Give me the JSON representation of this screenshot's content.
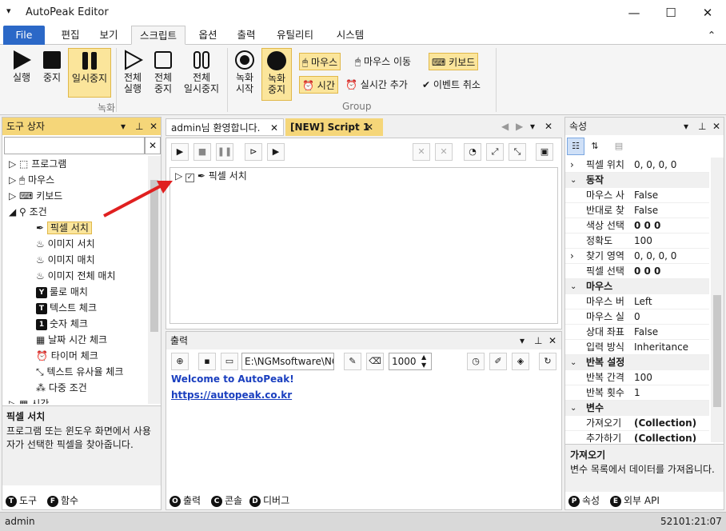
{
  "window": {
    "title": "AutoPeak Editor",
    "minimize": "—",
    "maximize": "☐",
    "close": "✕",
    "menu_glyph": "▾"
  },
  "menu": {
    "file": "File",
    "tabs": [
      "편집",
      "보기",
      "스크립트",
      "옵션",
      "출력",
      "유틸리티",
      "시스템"
    ],
    "collapse": "⌃"
  },
  "ribbon": {
    "run": "실행",
    "stop": "중지",
    "pause": "일시중지",
    "run_all": [
      "전체",
      "실행"
    ],
    "stop_all": [
      "전체",
      "중지"
    ],
    "pause_all": [
      "전체",
      "일시중지"
    ],
    "group1": "녹화",
    "rec_start": [
      "녹화",
      "시작"
    ],
    "rec_stop": [
      "녹화",
      "중지"
    ],
    "mouse": "마우스",
    "mouse_move": "마우스 이동",
    "keyboard": "키보드",
    "time": "시간",
    "realtime_add": "실시간 추가",
    "event_cancel": "이벤트 취소",
    "group2": "Group"
  },
  "toolbox": {
    "title": "도구 상자",
    "search_placeholder": "",
    "items": [
      "프로그램",
      "마우스",
      "키보드",
      "조건",
      "픽셀 서치",
      "이미지 서치",
      "이미지 매치",
      "이미지 전체 매치",
      "룰로 매치",
      "텍스트 체크",
      "숫자 체크",
      "날짜 시간 체크",
      "타이머 체크",
      "텍스트 유사율 체크",
      "다중 조건",
      "시간"
    ],
    "desc_title": "픽셀 서치",
    "desc_text": "프로그램 또는 윈도우 화면에서 사용자가 선택한 픽셀을 찾아줍니다.",
    "tabs": [
      "도구",
      "함수"
    ]
  },
  "editor": {
    "tabs": [
      "admin님 환영합니다.",
      "[NEW] Script 1"
    ],
    "script_item": "픽셀 서치"
  },
  "output": {
    "title": "출력",
    "path": "E:\\NGMsoftware\\NG",
    "delay": "1000",
    "lines": [
      "Welcome to AutoPeak!",
      "https://autopeak.co.kr"
    ],
    "tabs": [
      "출력",
      "콘솔",
      "디버그"
    ]
  },
  "properties": {
    "title": "속성",
    "rows": [
      {
        "k": "픽셀 위치",
        "v": "0, 0, 0, 0",
        "t": "row",
        "exp": ">"
      },
      {
        "k": "동작",
        "v": "",
        "t": "cat"
      },
      {
        "k": "마우스 사",
        "v": "False",
        "t": "row"
      },
      {
        "k": "반대로 찾",
        "v": "False",
        "t": "row"
      },
      {
        "k": "색상 선택",
        "v": "0 0 0",
        "t": "bold"
      },
      {
        "k": "정확도",
        "v": "100",
        "t": "row"
      },
      {
        "k": "찾기 영역",
        "v": "0, 0, 0, 0",
        "t": "row",
        "exp": ">"
      },
      {
        "k": "픽셀 선택",
        "v": "0 0 0",
        "t": "bold"
      },
      {
        "k": "마우스",
        "v": "",
        "t": "cat"
      },
      {
        "k": "마우스 버",
        "v": "Left",
        "t": "row"
      },
      {
        "k": "마우스 실",
        "v": "0",
        "t": "row"
      },
      {
        "k": "상대 좌표",
        "v": "False",
        "t": "row"
      },
      {
        "k": "입력 방식",
        "v": "Inheritance",
        "t": "row"
      },
      {
        "k": "반복 설정",
        "v": "",
        "t": "cat"
      },
      {
        "k": "반복 간격",
        "v": "100",
        "t": "row"
      },
      {
        "k": "반복 횟수",
        "v": "1",
        "t": "row"
      },
      {
        "k": "변수",
        "v": "",
        "t": "cat"
      },
      {
        "k": "가져오기",
        "v": "(Collection)",
        "t": "bold"
      },
      {
        "k": "추가하기",
        "v": "(Collection)",
        "t": "bold"
      }
    ],
    "desc_title": "가져오기",
    "desc_text": "변수 목록에서 데이터를 가져옵니다.",
    "tabs": [
      "속성",
      "외부 API"
    ]
  },
  "status": {
    "user": "admin",
    "time": "52101:21:07"
  },
  "colors": {
    "accent": "#2b68c7",
    "highlight": "#fbe59b",
    "panel_header": "#f5d679",
    "link": "#1a3fbf"
  }
}
